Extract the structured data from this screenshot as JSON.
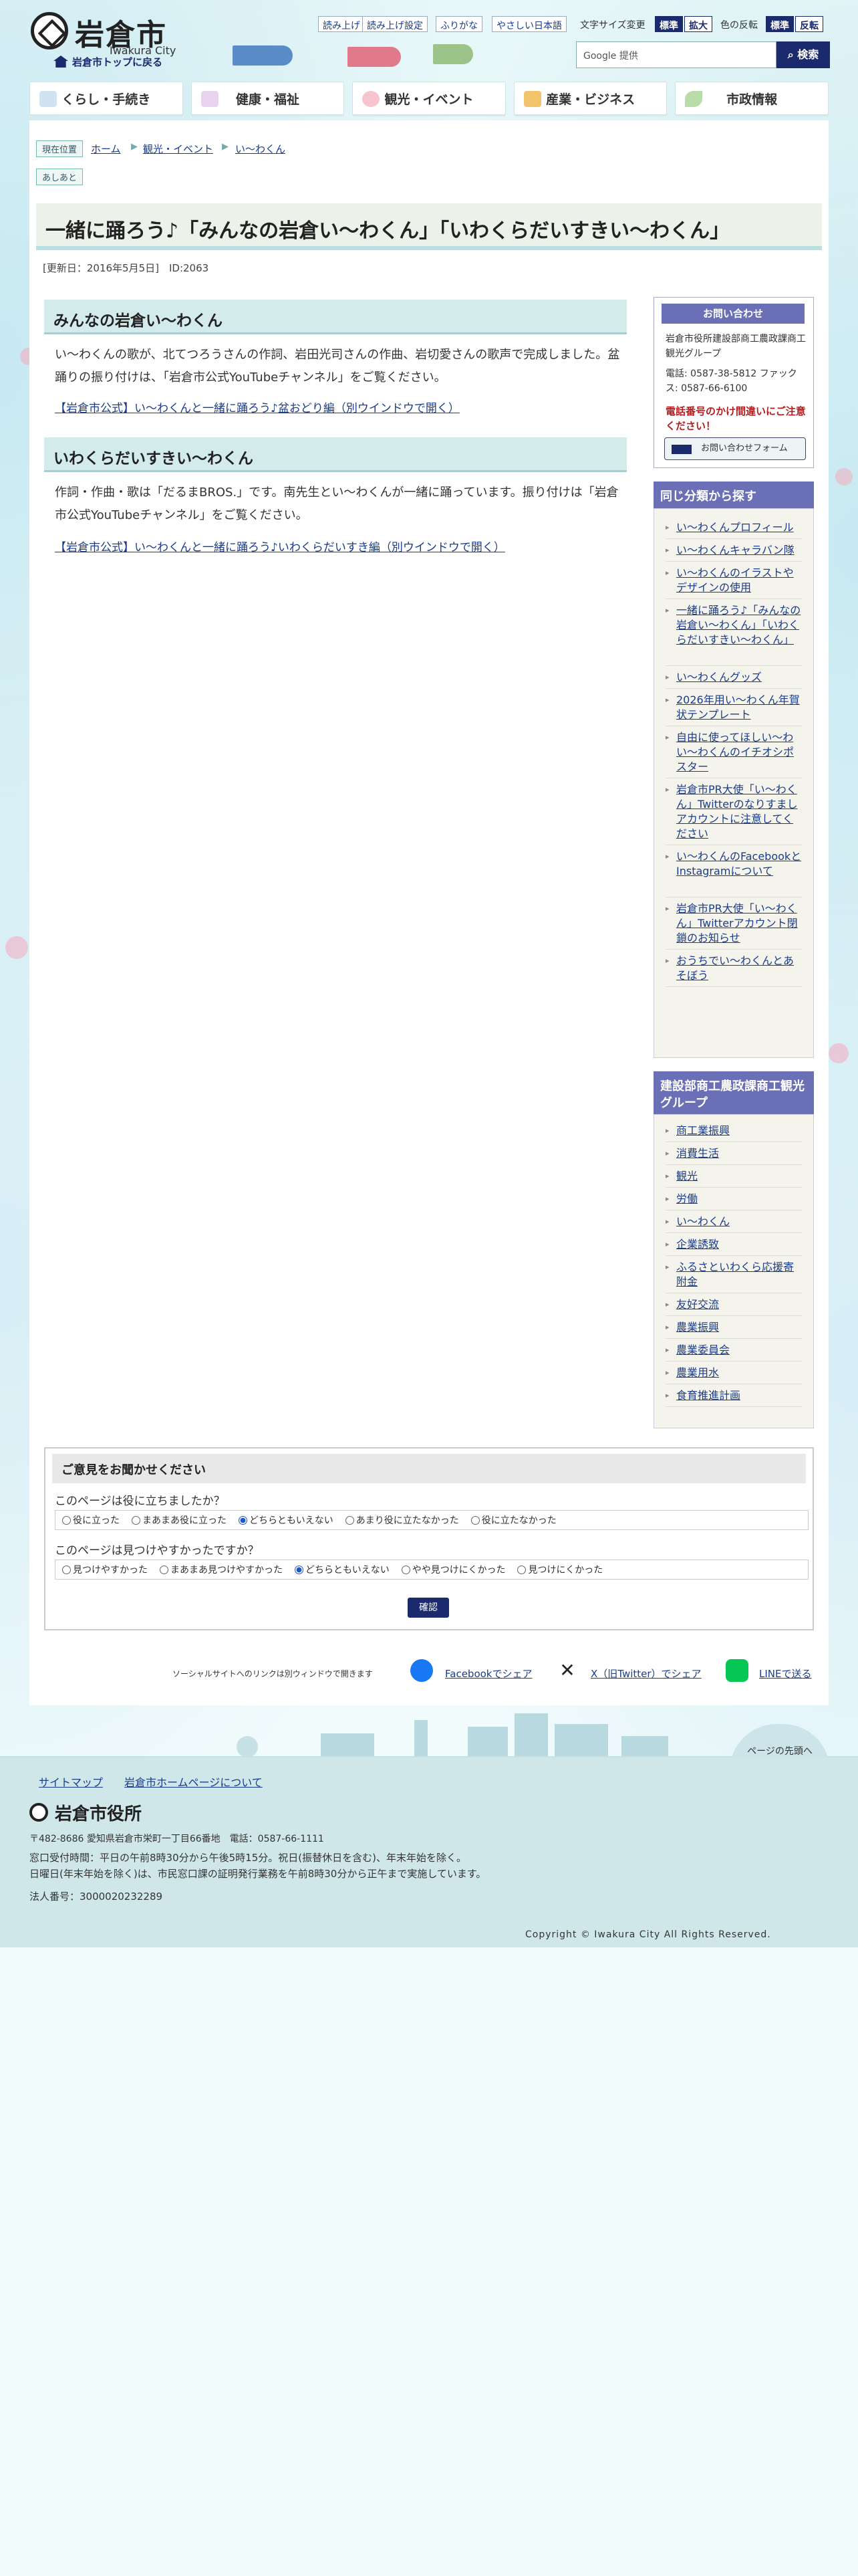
{
  "header": {
    "logo_text": "岩倉市",
    "logo_sub": "Iwakura City",
    "home_link": "岩倉市トップに戻る",
    "tools": {
      "read_aloud": "読み上げ",
      "read_settings": "読み上げ設定",
      "furigana": "ふりがな",
      "easy_japanese": "やさしい日本語",
      "font_size_label": "文字サイズ変更",
      "font_standard": "標準",
      "font_large": "拡大",
      "color_label": "色の反転",
      "color_standard": "標準",
      "color_invert": "反転"
    },
    "search": {
      "placeholder": "Google 提供",
      "button": "検索"
    }
  },
  "nav": {
    "items": [
      {
        "label": "くらし・手続き",
        "icon": "house-icon"
      },
      {
        "label": "健康・福祉",
        "icon": "family-icon"
      },
      {
        "label": "観光・イベント",
        "icon": "sakura-icon"
      },
      {
        "label": "産業・ビジネス",
        "icon": "briefcase-icon"
      },
      {
        "label": "市政情報",
        "icon": "leaf-icon"
      }
    ]
  },
  "breadcrumb": {
    "tag": "現在位置",
    "items": [
      "ホーム",
      "観光・イベント",
      "い〜わくん"
    ],
    "history_tag": "あしあと"
  },
  "page": {
    "title": "一緒に踊ろう♪「みんなの岩倉い〜わくん」「いわくらだいすきい〜わくん」",
    "updated": "[更新日：2016年5月5日]　ID:2063",
    "sections": [
      {
        "heading": "みんなの岩倉い〜わくん",
        "text": "い〜わくんの歌が、北てつろうさんの作詞、岩田光司さんの作曲、岩切愛さんの歌声で完成しました。盆踊りの振り付けは、「岩倉市公式YouTubeチャンネル」をご覧ください。",
        "link": "【岩倉市公式】い〜わくんと一緒に踊ろう♪盆おどり編（別ウインドウで開く）"
      },
      {
        "heading": "いわくらだいすきい〜わくん",
        "text": "作詞・作曲・歌は「だるまBROS.」です。南先生とい〜わくんが一緒に踊っています。振り付けは「岩倉市公式YouTubeチャンネル」をご覧ください。",
        "link": "【岩倉市公式】い〜わくんと一緒に踊ろう♪いわくらだいすき編（別ウインドウで開く）"
      }
    ]
  },
  "sidebar": {
    "contact": {
      "heading": "お問い合わせ",
      "department": "岩倉市役所建設部商工農政課商工観光グループ",
      "phone": "電話: 0587-38-5812 ファックス: 0587-66-6100",
      "warning": "電話番号のかけ間違いにご注意ください！",
      "form_button": "お問い合わせフォーム"
    },
    "related": {
      "heading": "同じ分類から探す",
      "items": [
        "い〜わくんプロフィール",
        "い〜わくんキャラバン隊",
        "い〜わくんのイラストやデザインの使用",
        "一緒に踊ろう♪「みんなの岩倉い〜わくん」「いわくらだいすきい〜わくん」",
        "い〜わくんグッズ",
        "2026年用い〜わくん年賀状テンプレート",
        "自由に使ってほしい〜わい〜わくんのイチオシポスター",
        "岩倉市PR大使「い〜わくん」Twitterのなりすましアカウントに注意してください",
        "い〜わくんのFacebookとInstagramについて",
        "岩倉市PR大使「い〜わくん」Twitterアカウント閉鎖のお知らせ",
        "おうちでい〜わくんとあそぼう"
      ]
    },
    "group": {
      "heading": "建設部商工農政課商工観光グループ",
      "items": [
        "商工業振興",
        "消費生活",
        "観光",
        "労働",
        "い〜わくん",
        "企業誘致",
        "ふるさといわくら応援寄附金",
        "友好交流",
        "農業振興",
        "農業委員会",
        "農業用水",
        "食育推進計画"
      ]
    }
  },
  "survey": {
    "heading": "ご意見をお聞かせください",
    "q1": "このページは役に立ちましたか？",
    "q1_options": [
      "役に立った",
      "まあまあ役に立った",
      "どちらともいえない",
      "あまり役に立たなかった",
      "役に立たなかった"
    ],
    "q1_selected": 2,
    "q2": "このページは見つけやすかったですか？",
    "q2_options": [
      "見つけやすかった",
      "まあまあ見つけやすかった",
      "どちらともいえない",
      "やや見つけにくかった",
      "見つけにくかった"
    ],
    "q2_selected": 2,
    "confirm": "確認"
  },
  "share": {
    "note": "ソーシャルサイトへのリンクは別ウィンドウで開きます",
    "facebook": "Facebookでシェア",
    "x": "X（旧Twitter）でシェア",
    "line": "LINEで送る"
  },
  "footer": {
    "links": [
      "サイトマップ",
      "岩倉市ホームページについて"
    ],
    "page_top": "ページの先頭へ",
    "title": "岩倉市役所",
    "address": "〒482-8686 愛知県岩倉市栄町一丁目66番地　電話：0587-66-1111",
    "hours_1": "窓口受付時間：平日の午前8時30分から午後5時15分。祝日(振替休日を含む)、年末年始を除く。",
    "hours_2": "日曜日(年末年始を除く)は、市民窓口課の証明発行業務を午前8時30分から正午まで実施しています。",
    "corp_no": "法人番号：3000020232289",
    "copyright": "Copyright © Iwakura City All Rights Reserved."
  },
  "colors": {
    "navy": "#1a2a6c",
    "side_heading": "#6a6fb6",
    "heading_bg": "#d3ebeb",
    "footer_bg": "#d0e7ea"
  }
}
